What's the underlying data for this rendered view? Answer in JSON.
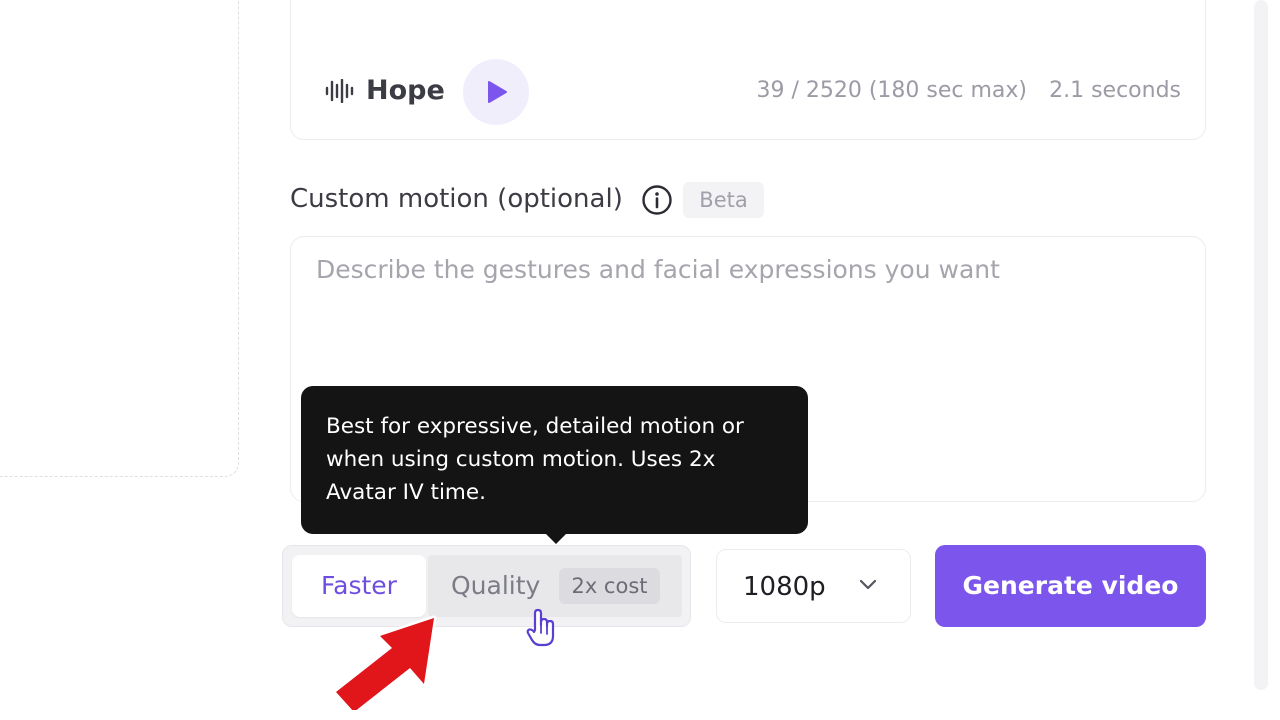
{
  "voice": {
    "name": "Hope",
    "char_count": "39 / 2520 (180 sec max)",
    "duration": "2.1 seconds",
    "icons": [
      "waveform-icon",
      "play-icon"
    ]
  },
  "custom_motion": {
    "label": "Custom motion (optional)",
    "badge": "Beta",
    "placeholder": "Describe the gestures and facial expressions you want",
    "value": "",
    "icon": "info-icon"
  },
  "tooltip": {
    "text": "Best for expressive, detailed motion or when using custom motion. Uses 2x Avatar IV time."
  },
  "mode_toggle": {
    "options": [
      {
        "label": "Faster",
        "selected": true
      },
      {
        "label": "Quality",
        "badge": "2x cost",
        "selected": false,
        "hovered": true
      }
    ]
  },
  "resolution": {
    "selected": "1080p",
    "icon": "chevron-down-icon"
  },
  "generate": {
    "label": "Generate video"
  },
  "colors": {
    "accent": "#7b55ec",
    "accent_text": "#6d4ee0",
    "tooltip_bg": "#141414",
    "annotation_arrow": "#e0161b"
  }
}
